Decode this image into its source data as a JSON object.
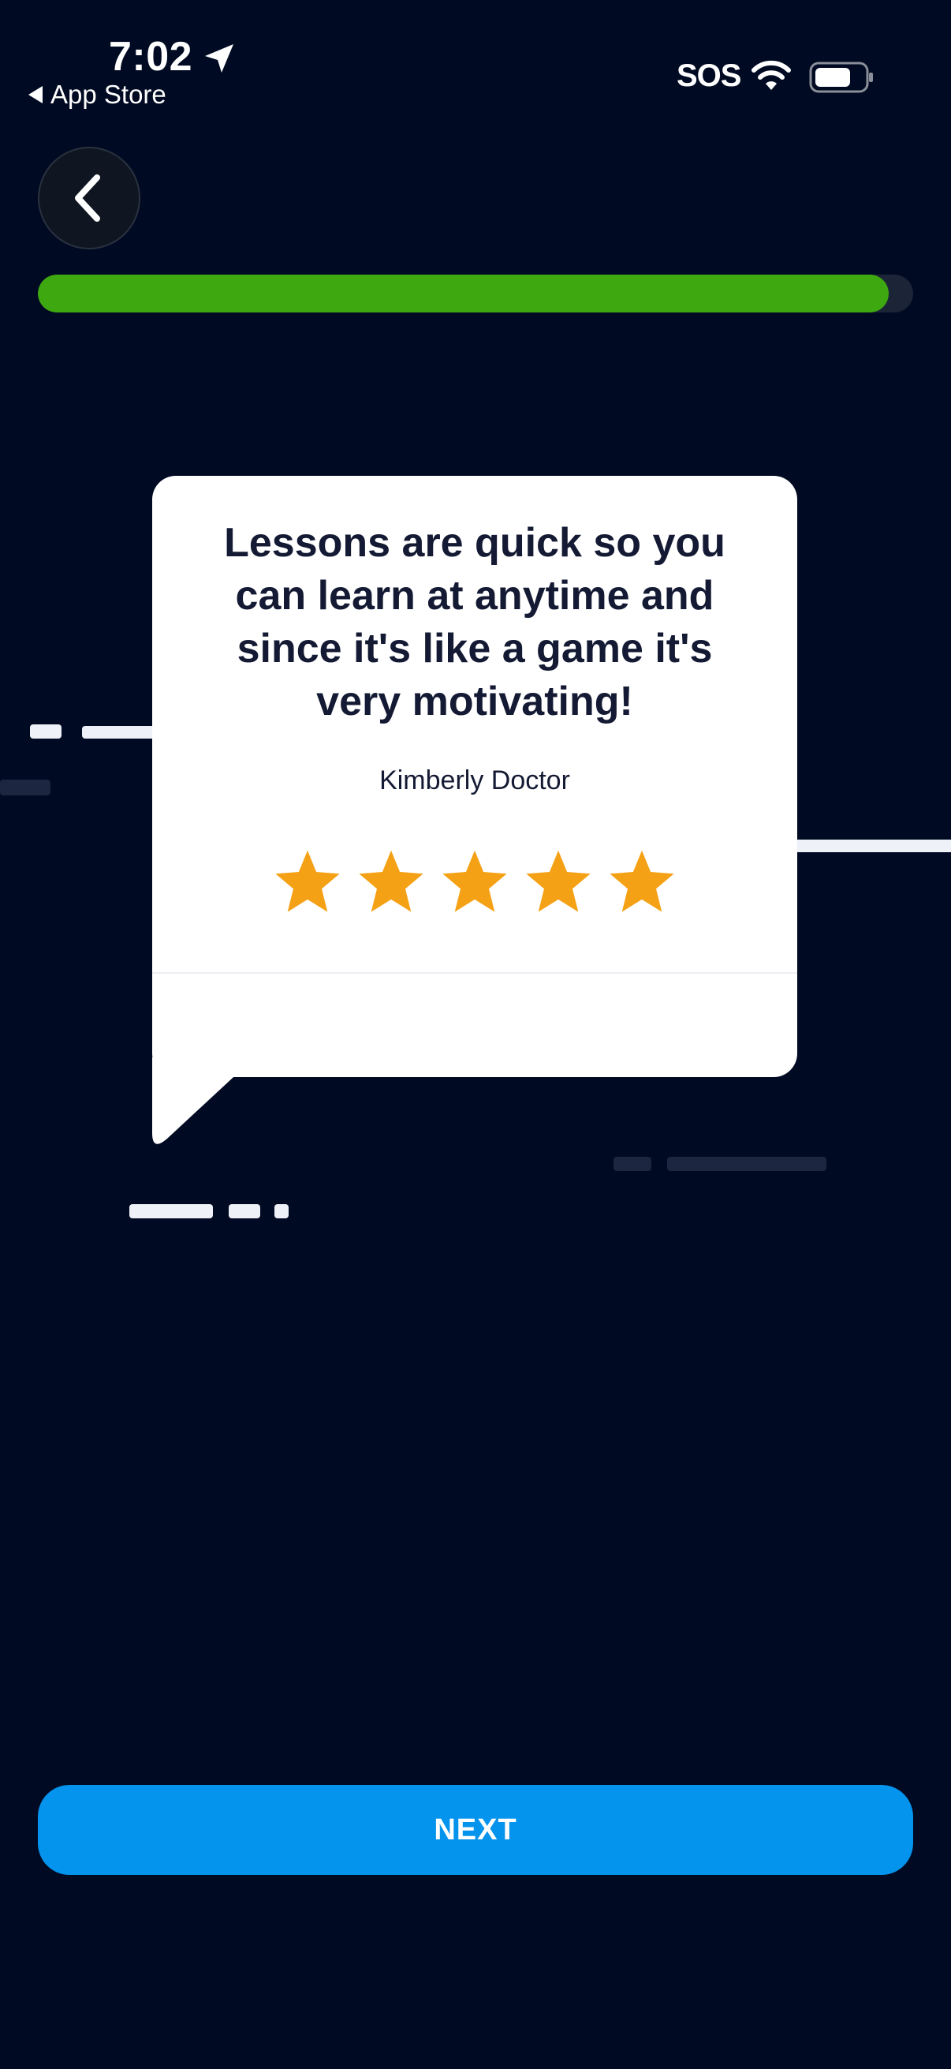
{
  "status_bar": {
    "time": "7:02",
    "back_label": "App Store",
    "sos": "SOS"
  },
  "progress": {
    "fraction": 0.972
  },
  "review": {
    "quote": "Lessons are quick so you can learn at anytime and since it's like a game it's very motivating!",
    "author": "Kimberly Doctor",
    "rating": 5,
    "star_color": "#f5a115"
  },
  "actions": {
    "next_label": "NEXT"
  },
  "colors": {
    "background": "#000a22",
    "progress_fill": "#3ea811",
    "accent": "#0493ed"
  }
}
